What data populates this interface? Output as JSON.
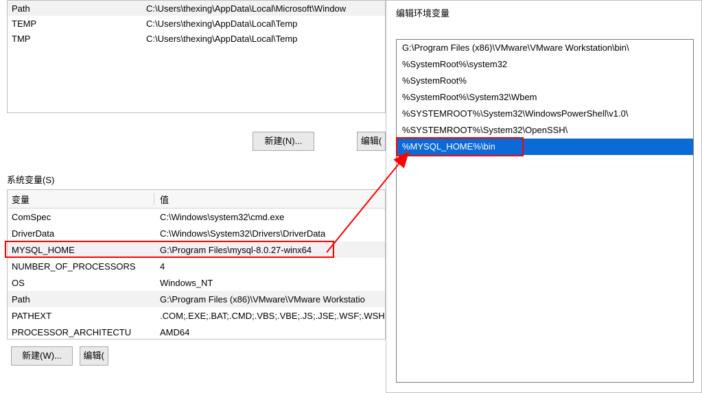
{
  "user_vars": {
    "rows": [
      {
        "name": "Path",
        "value": "C:\\Users\\thexing\\AppData\\Local\\Microsoft\\Window"
      },
      {
        "name": "TEMP",
        "value": "C:\\Users\\thexing\\AppData\\Local\\Temp"
      },
      {
        "name": "TMP",
        "value": "C:\\Users\\thexing\\AppData\\Local\\Temp"
      }
    ]
  },
  "buttons": {
    "new_user": "新建(N)...",
    "edit_user": "编辑(",
    "new_sys": "新建(W)...",
    "edit_sys": "编辑("
  },
  "labels": {
    "sys_section": "系统变量(S)",
    "var_col": "变量",
    "val_col": "值",
    "right_title": "编辑环境变量"
  },
  "sys_vars": {
    "rows": [
      {
        "name": "ComSpec",
        "value": "C:\\Windows\\system32\\cmd.exe"
      },
      {
        "name": "DriverData",
        "value": "C:\\Windows\\System32\\Drivers\\DriverData"
      },
      {
        "name": "MYSQL_HOME",
        "value": "G:\\Program Files\\mysql-8.0.27-winx64"
      },
      {
        "name": "NUMBER_OF_PROCESSORS",
        "value": "4"
      },
      {
        "name": "OS",
        "value": "Windows_NT"
      },
      {
        "name": "Path",
        "value": "G:\\Program Files (x86)\\VMware\\VMware Workstatio"
      },
      {
        "name": "PATHEXT",
        "value": ".COM;.EXE;.BAT;.CMD;.VBS;.VBE;.JS;.JSE;.WSF;.WSH;.M"
      },
      {
        "name": "PROCESSOR_ARCHITECTU",
        "value": "AMD64"
      }
    ],
    "highlight_idx": 2
  },
  "path_items": [
    "G:\\Program Files (x86)\\VMware\\VMware Workstation\\bin\\",
    "%SystemRoot%\\system32",
    "%SystemRoot%",
    "%SystemRoot%\\System32\\Wbem",
    "%SYSTEMROOT%\\System32\\WindowsPowerShell\\v1.0\\",
    "%SYSTEMROOT%\\System32\\OpenSSH\\",
    "%MYSQL_HOME%\\bin"
  ],
  "path_selected_idx": 6
}
